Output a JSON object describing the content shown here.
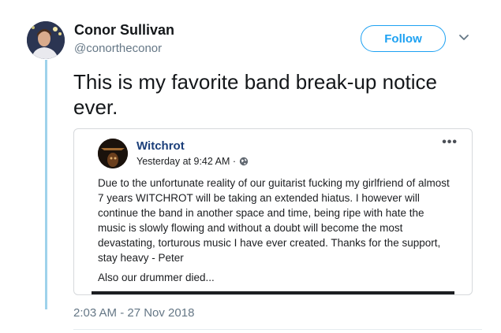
{
  "tweet": {
    "author_name": "Conor Sullivan",
    "author_handle": "@conortheconor",
    "follow_label": "Follow",
    "text": "This is my favorite band break-up notice ever.",
    "timestamp": "2:03 AM - 27 Nov 2018"
  },
  "embedded_post": {
    "page_name": "Witchrot",
    "post_time": "Yesterday at 9:42 AM ·",
    "paragraph_1": "Due to the unfortunate reality of our guitarist fucking my girlfriend of almost 7 years WITCHROT will be taking an extended hiatus. I however will continue the band in another space and time, being ripe with hate the music is slowly flowing and without a doubt will become the most devastating, torturous music I have ever created. Thanks for the support, stay heavy - Peter",
    "paragraph_2": "Also our drummer died...",
    "more_icon": "•••"
  },
  "icons": {
    "caret": "chevron-down-icon",
    "privacy": "globe-icon",
    "more": "more-horizontal-icon"
  },
  "colors": {
    "accent": "#1da1f2",
    "thread_line": "#9ed2eb",
    "page_name": "#1c3f7a",
    "muted": "#657786"
  }
}
